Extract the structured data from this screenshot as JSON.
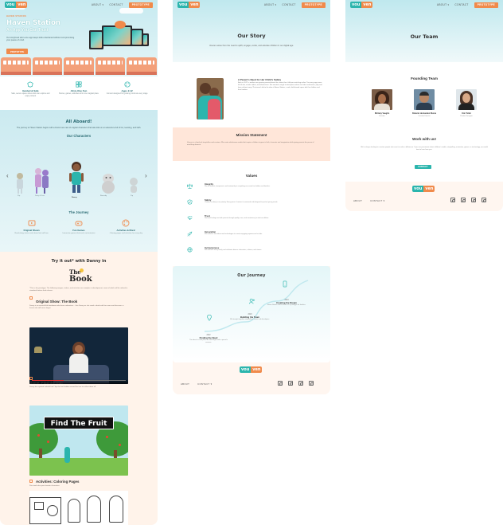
{
  "brand": {
    "part1": "vou",
    "part2": "ven",
    "color_teal": "#2bb5ad",
    "color_orange": "#f08a4b"
  },
  "nav": {
    "about": "ABOUT ▾",
    "contact": "CONTACT",
    "cta": "PROTOTYPE"
  },
  "home": {
    "kicker": "HAVEN STUDIOS",
    "title": "Haven Station",
    "subtitle": "An App You Can Trust",
    "description": "Our storybook all-in-one app keeps kids entertained without compromising your peace of mind.",
    "cta": "PROTOTYPE",
    "features": [
      {
        "icon": "shield-icon",
        "title": "Guided & Safe",
        "desc": "Safe, secure space where kids can explore and enjoy content"
      },
      {
        "icon": "grid-icon",
        "title": "All-in-One Fun",
        "desc": "Stories, games, activities all in one magical place"
      },
      {
        "icon": "palette-icon",
        "title": "Ages 2-12",
        "desc": "Content designed for growing minds at every stage"
      }
    ],
    "aboard_title": "All Aboard!",
    "aboard_intro": "The journey to Haven Station begins with a brand new cast of original characters that take kids on an adventure full of fun, learning, and faith.",
    "characters_title": "Our Characters",
    "characters": [
      "Pip",
      "Daisy & Leo",
      "Danny",
      "Barnaby",
      "Zip"
    ],
    "journey_title": "The Journey",
    "journey_items": [
      {
        "icon": "tv-icon",
        "title": "Original Shows",
        "desc": "Read-along stories and shows kids will love"
      },
      {
        "icon": "gamepad-icon",
        "title": "Fun Games",
        "desc": "Interactive games that teach and entertain"
      },
      {
        "icon": "palette-icon",
        "title": "Activities & More!",
        "desc": "Coloring pages and activities for every day"
      }
    ],
    "tryout_title": "Try it out* with Danny in",
    "book_logo_top": "The",
    "book_logo_bottom": "Book",
    "tryout_desc": "*This is the prototype. The following images, videos, and activities are samples in development, some of which will be refined to standards before final release.",
    "show_title": "Original Show: The Book",
    "show_desc": "Danny is an excited little bookworm who loves adventure... Join Danny as she reads a book with her mom and discovers a lesson she will never forget.",
    "video_progress": 0.34,
    "game_title": "Game: Find the fruit",
    "game_desc": "Danny has spotted colorful fruit! Tap the fruit hidden around the tree to collect them all.",
    "game_banner": "Find The Fruit",
    "coloring_title": "Activities: Coloring Pages",
    "coloring_desc": "Print and color your favorite characters."
  },
  "story": {
    "title": "Our Story",
    "intro": "Voucen arose from the need to uplift, engage, excite, and educate children in our digital age.",
    "section_title": "A Parent's Need for Her Child's Safety",
    "section_text": "Back in 2022, a mother was growing worried about the content her child was watching online. Too many apps were full of ads, unsafe videos, and distractions. She wanted a single trusted place where her kids could watch, play and learn without worry. That search led to the idea of Haven Station, a safe, faith-based space built for children and their families.",
    "mission_title": "Mission Statement",
    "mission_text": "Voucen is a family of storytellers and creators. We create wholesome media that inspires children to grow in faith, character and imagination while giving parents the peace of mind they deserve.",
    "values_title": "Values",
    "values": [
      {
        "icon": "scales-icon",
        "title": "Integrity",
        "desc": "We are honest, transparent, and trustworthy in everything we create for children and families."
      },
      {
        "icon": "shield-check-icon",
        "title": "Safety",
        "desc": "Children's safety is our priority. Every piece of content is reviewed and designed to protect young minds."
      },
      {
        "icon": "handshake-icon",
        "title": "Trust",
        "desc": "We build lasting trust with parents through quality, care, and consistency in what we deliver."
      },
      {
        "icon": "rocket-icon",
        "title": "Innovation",
        "desc": "We embrace new ideas and technologies to create engaging experiences for kids."
      },
      {
        "icon": "globe-icon",
        "title": "Inclusiveness",
        "desc": "We welcome every family and celebrate diverse characters, cultures, and stories."
      }
    ],
    "journey_title": "Our Journey",
    "journey_steps": [
      {
        "icon": "lightbulb-icon",
        "year": "2022",
        "title": "Finding the Need",
        "desc": "The idea of a safe place for kids began with a parent's concern."
      },
      {
        "icon": "add-user-icon",
        "year": "2023",
        "title": "Building the Team",
        "desc": "We brought together storytellers, artists and developers."
      },
      {
        "icon": "phone-icon",
        "year": "2024",
        "title": "Creating the Dream",
        "desc": "Haven Station comes to life as a prototype for families."
      }
    ]
  },
  "team": {
    "title": "Our Team",
    "founding_title": "Founding Team",
    "members": [
      {
        "name": "Brittany Vaughn",
        "role": "Founder"
      },
      {
        "name": "Roberto Hernandez Rivera",
        "role": "Creative Director"
      },
      {
        "name": "Kim Tollet",
        "role": "Product Designer"
      }
    ],
    "work_title": "Work with us!",
    "work_text": "We're always looking for creative people who want to make a difference. If you are passionate about children's media, storytelling, animation, games, or technology, we would love to hear from you.",
    "contact_btn": "CONTACT"
  },
  "footer": {
    "about": "ABOUT",
    "contact": "CONTACT ▾"
  }
}
